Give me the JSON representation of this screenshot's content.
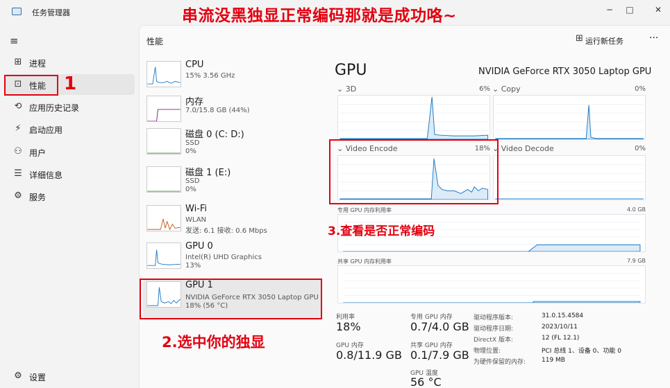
{
  "window": {
    "title": "任务管理器",
    "minimize": "−",
    "maximize": "□",
    "close": "✕"
  },
  "overlay_title": "串流没黑独显正常编码那就是成功咯~",
  "sidebar": {
    "menu_icon": "≡",
    "items": [
      {
        "label": "进程",
        "icon": "processes-icon",
        "glyph": "⊞"
      },
      {
        "label": "性能",
        "icon": "performance-icon",
        "glyph": "⊡"
      },
      {
        "label": "应用历史记录",
        "icon": "history-icon",
        "glyph": "⟲"
      },
      {
        "label": "启动应用",
        "icon": "startup-icon",
        "glyph": "⚡"
      },
      {
        "label": "用户",
        "icon": "users-icon",
        "glyph": "⚇"
      },
      {
        "label": "详细信息",
        "icon": "details-icon",
        "glyph": "☰"
      },
      {
        "label": "服务",
        "icon": "services-icon",
        "glyph": "⚙"
      }
    ],
    "settings": {
      "label": "设置",
      "glyph": "⚙"
    }
  },
  "header": {
    "title": "性能",
    "run_task": "运行新任务",
    "more": "···"
  },
  "devices": [
    {
      "name": "CPU",
      "line1": "15% 3.56 GHz",
      "line2": "",
      "line3": ""
    },
    {
      "name": "内存",
      "line1": "7.0/15.8 GB (44%)",
      "line2": "",
      "line3": ""
    },
    {
      "name": "磁盘 0 (C: D:)",
      "line1": "SSD",
      "line2": "0%",
      "line3": ""
    },
    {
      "name": "磁盘 1 (E:)",
      "line1": "SSD",
      "line2": "0%",
      "line3": ""
    },
    {
      "name": "Wi-Fi",
      "line1": "WLAN",
      "line2": "发送: 6.1 接收: 0.6 Mbps",
      "line3": ""
    },
    {
      "name": "GPU 0",
      "line1": "Intel(R) UHD Graphics",
      "line2": "13%",
      "line3": ""
    },
    {
      "name": "GPU 1",
      "line1": "NVIDIA GeForce RTX 3050 Laptop GPU",
      "line2": "18% (56 °C)",
      "line3": ""
    }
  ],
  "detail": {
    "title": "GPU",
    "model": "NVIDIA GeForce RTX 3050 Laptop GPU",
    "engines": [
      {
        "label": "3D",
        "pct": "6%"
      },
      {
        "label": "Copy",
        "pct": "0%"
      },
      {
        "label": "Video Encode",
        "pct": "18%"
      },
      {
        "label": "Video Decode",
        "pct": "0%"
      }
    ],
    "dedicated_label": "专用 GPU 内存利用率",
    "dedicated_max": "4.0 GB",
    "shared_label": "共享 GPU 内存利用率",
    "shared_max": "7.9 GB",
    "stats": {
      "util_label": "利用率",
      "util_value": "18%",
      "ded_label": "专用 GPU 内存",
      "ded_value": "0.7/4.0 GB",
      "gpumem_label": "GPU 内存",
      "gpumem_value": "0.8/11.9 GB",
      "shared_label": "共享 GPU 内存",
      "shared_value": "0.1/7.9 GB",
      "temp_label": "GPU 温度",
      "temp_value": "56 °C"
    },
    "info": [
      {
        "k": "驱动程序版本:",
        "v": "31.0.15.4584"
      },
      {
        "k": "驱动程序日期:",
        "v": "2023/10/11"
      },
      {
        "k": "DirectX 版本:",
        "v": "12 (FL 12.1)"
      },
      {
        "k": "物理位置:",
        "v": "PCI 总线 1、设备 0、功能 0"
      },
      {
        "k": "为硬件保留的内存:",
        "v": "119 MB"
      }
    ]
  },
  "annotations": {
    "step1": "1",
    "step2": "2.选中你的独显",
    "step3": "3.查看是否正常编码"
  },
  "colors": {
    "accent_red": "#e3000f",
    "gpu_line": "#1e7bc6",
    "mem_line": "#8b1a8b",
    "net_line": "#c85a1a",
    "disk_line": "#2e8b2e"
  }
}
